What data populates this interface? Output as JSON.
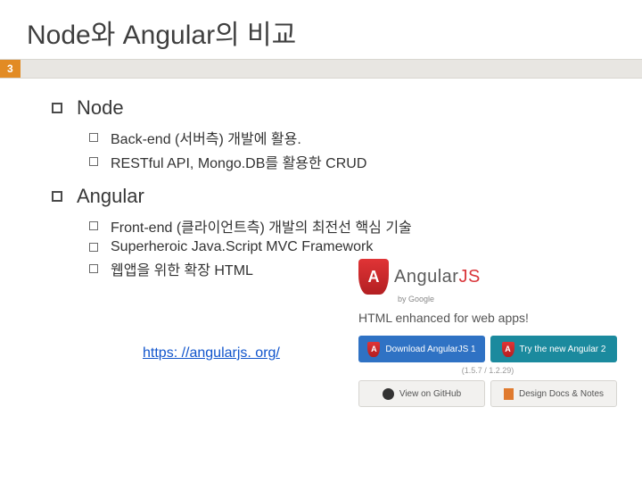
{
  "title": "Node와 Angular의 비교",
  "page_number": "3",
  "sections": {
    "node": {
      "heading": "Node",
      "items": [
        "Back-end (서버측) 개발에 활용.",
        "RESTful API, Mongo.DB를 활용한 CRUD"
      ]
    },
    "angular": {
      "heading": "Angular",
      "items": [
        "Front-end (클라이언트측) 개발의 최전선 핵심 기술",
        "Superheroic Java.Script MVC Framework",
        "웹앱을 위한 확장 HTML"
      ]
    }
  },
  "link": "https: //angularjs. org/",
  "promo": {
    "brand_prefix": "Angular",
    "brand_suffix": "JS",
    "by": "by Google",
    "tagline": "HTML enhanced for web apps!",
    "download_label": "Download AngularJS 1",
    "download_version": "(1.5.7 / 1.2.29)",
    "try_label": "Try the new Angular 2",
    "github_label": "View on GitHub",
    "docs_label": "Design Docs & Notes",
    "shield_letters": "A"
  }
}
